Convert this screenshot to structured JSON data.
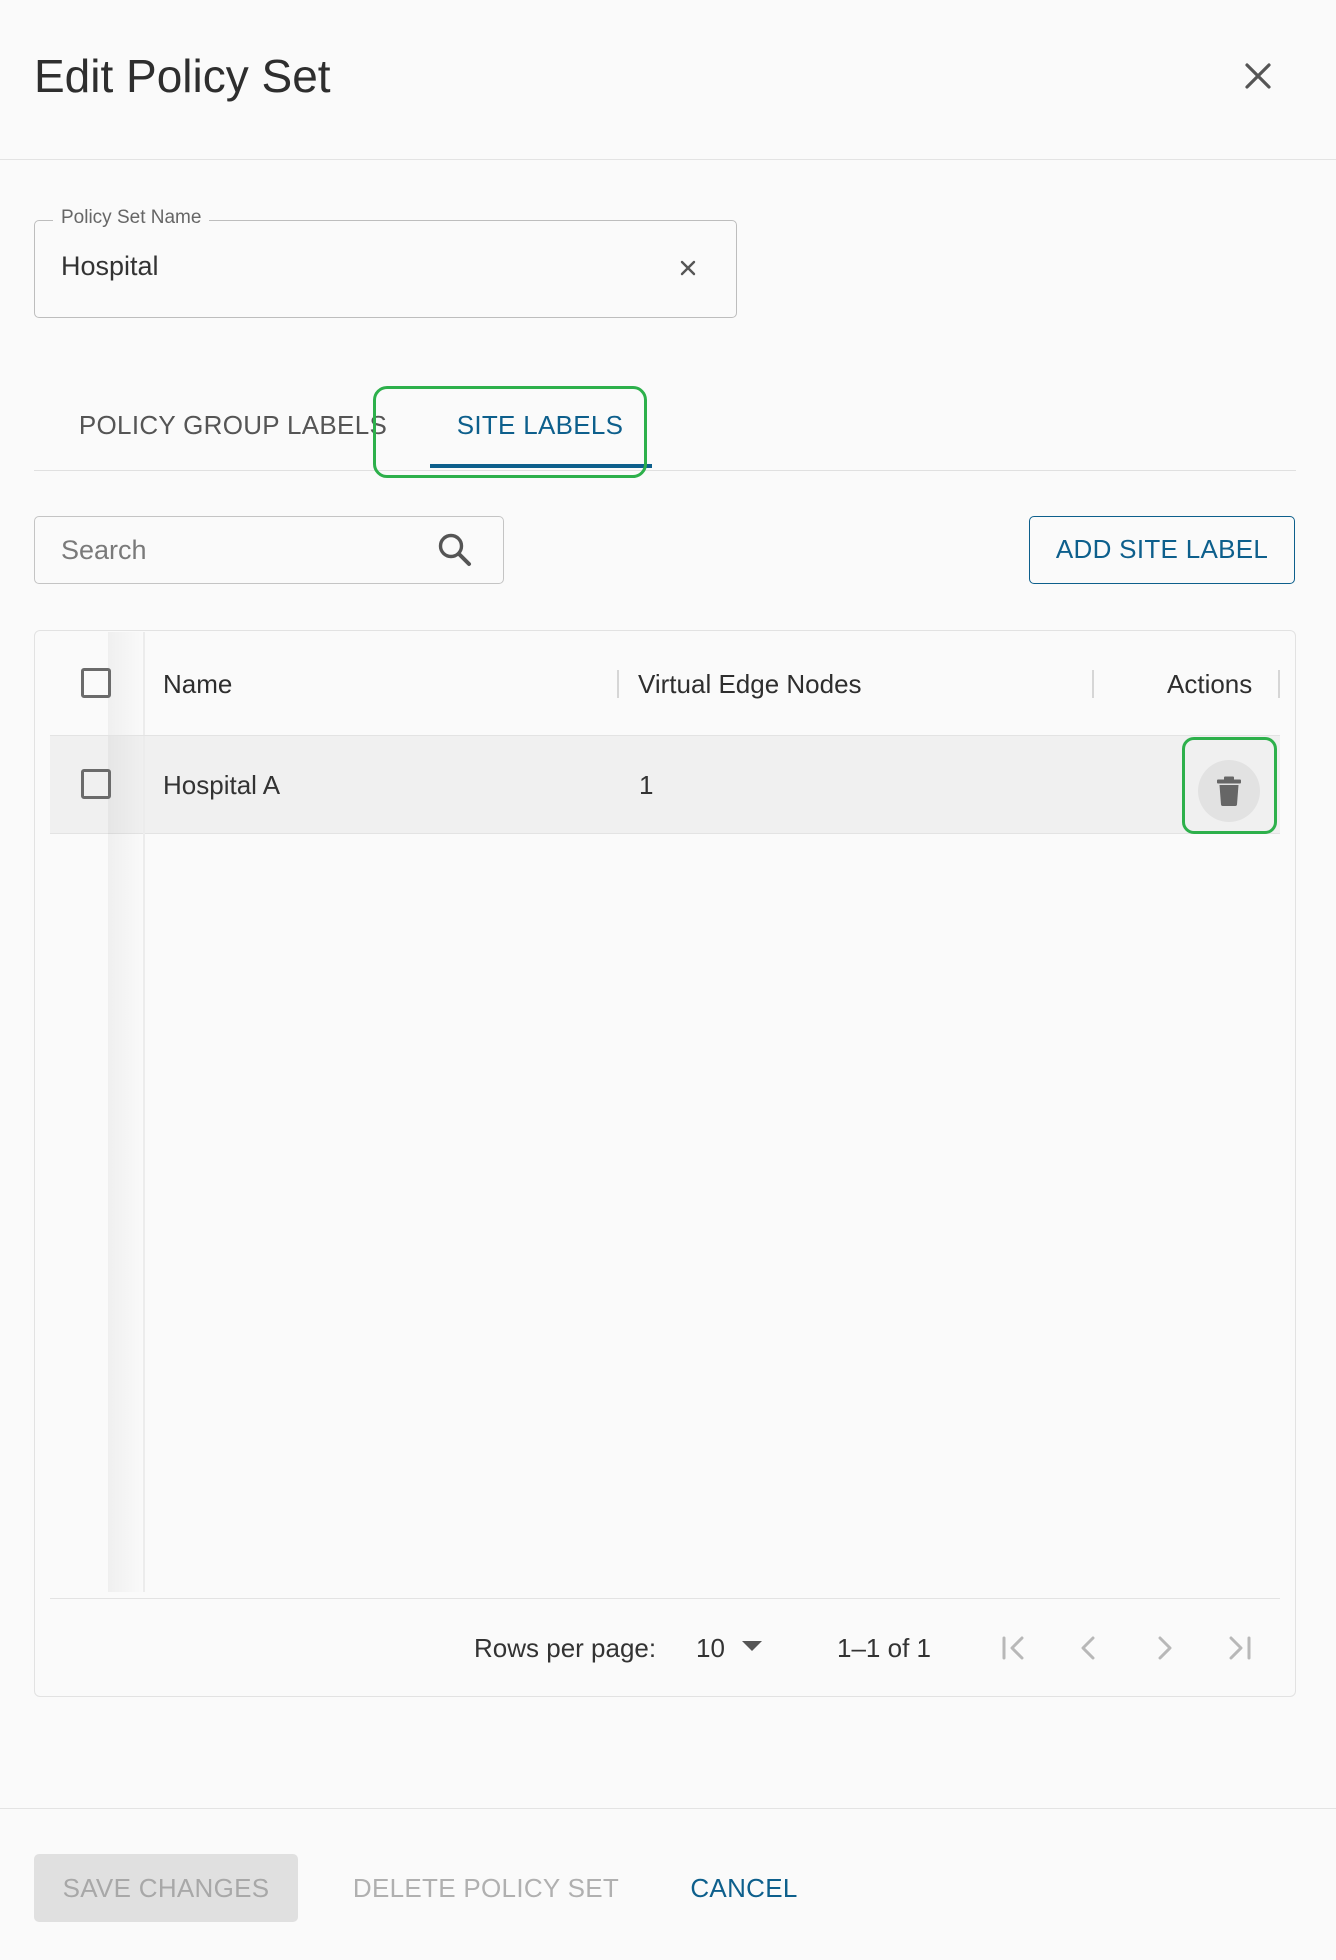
{
  "dialog": {
    "title": "Edit Policy Set"
  },
  "policy_set_name": {
    "label": "Policy Set Name",
    "value": "Hospital"
  },
  "tabs": [
    {
      "label": "POLICY GROUP LABELS",
      "selected": false
    },
    {
      "label": "SITE LABELS",
      "selected": true
    }
  ],
  "search": {
    "placeholder": "Search",
    "value": ""
  },
  "toolbar": {
    "add_label": "ADD SITE LABEL"
  },
  "table": {
    "columns": [
      "Name",
      "Virtual Edge Nodes",
      "Actions"
    ],
    "rows": [
      {
        "name": "Hospital A",
        "virtual_edge_nodes": "1"
      }
    ]
  },
  "pagination": {
    "rows_per_page_label": "Rows per page:",
    "rows_per_page": "10",
    "range": "1–1 of 1"
  },
  "footer": {
    "save_label": "SAVE CHANGES",
    "delete_label": "DELETE POLICY SET",
    "cancel_label": "CANCEL"
  },
  "colors": {
    "accent": "#0d5f8c",
    "highlight": "#2db04b",
    "disabled_text": "#a8a8a8"
  },
  "icons": [
    "close-icon",
    "clear-icon",
    "search-icon",
    "trash-icon",
    "first-page-icon",
    "prev-page-icon",
    "next-page-icon",
    "last-page-icon",
    "dropdown-caret-icon"
  ]
}
